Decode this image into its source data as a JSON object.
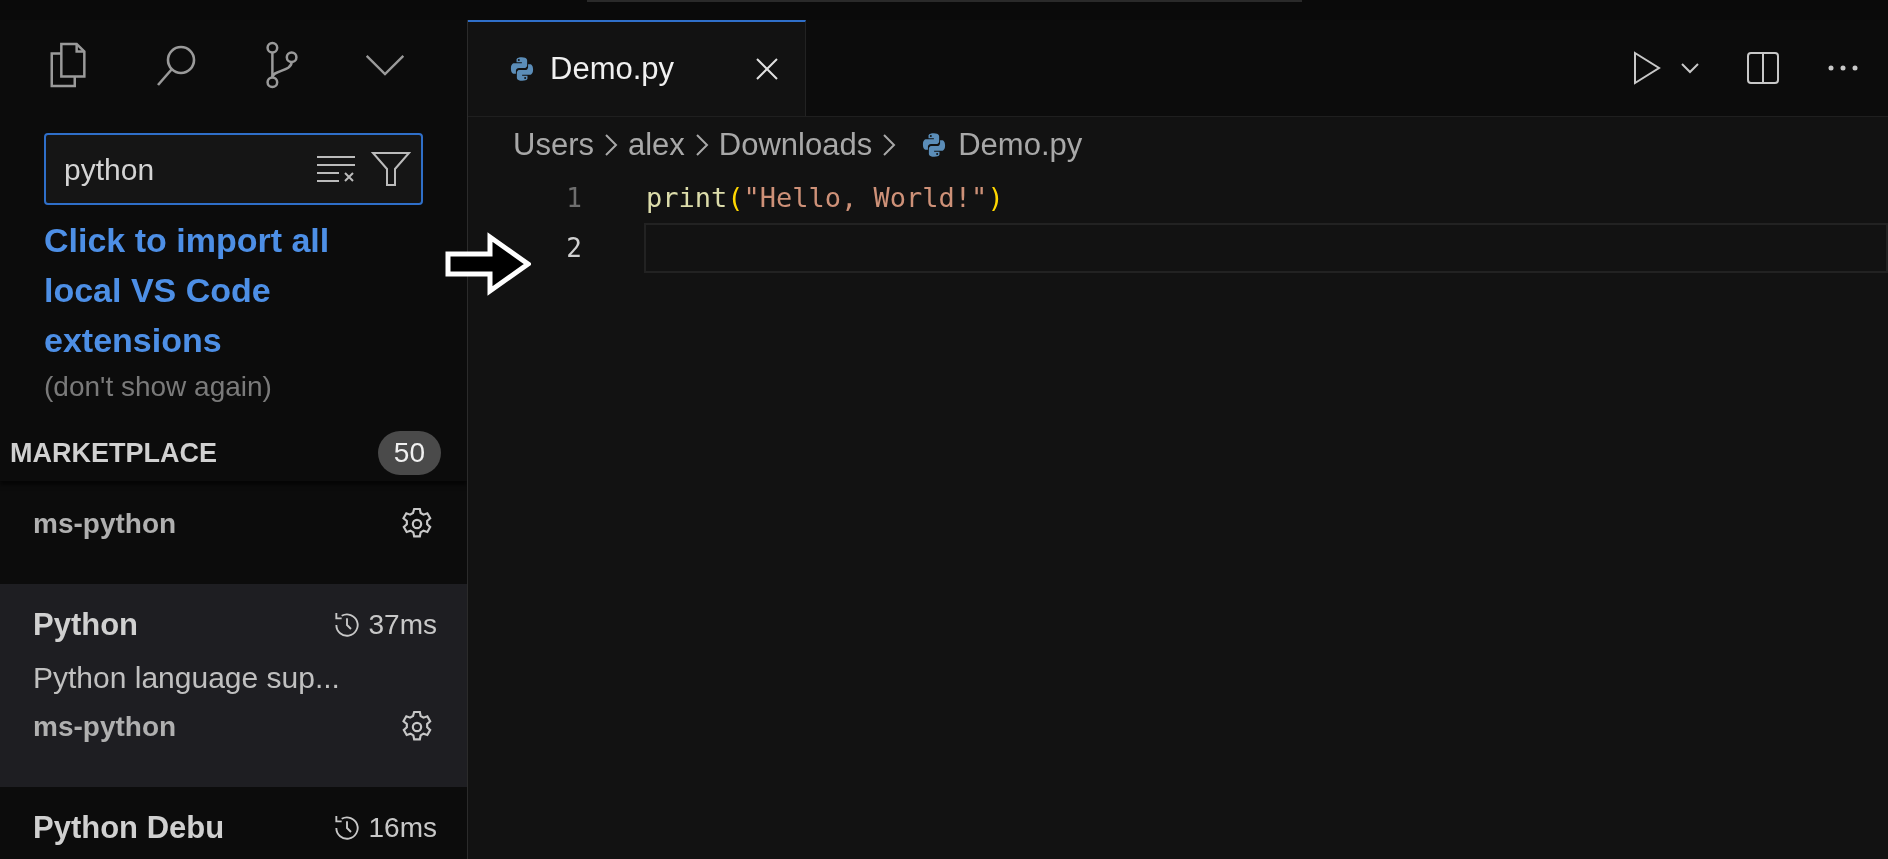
{
  "search": {
    "value": "python"
  },
  "import_notice": {
    "link": "Click to import all local VS Code extensions",
    "dismiss": "(don't show again)"
  },
  "marketplace": {
    "title": "MARKETPLACE",
    "count": "50",
    "items": [
      {
        "publisher": "ms-python",
        "selected": false
      },
      {
        "name": "Python",
        "time": "37ms",
        "description": "Python language sup...",
        "publisher": "ms-python",
        "selected": true
      },
      {
        "name": "Python Debu",
        "time": "16ms",
        "selected": false
      }
    ]
  },
  "editor": {
    "tabs": [
      {
        "label": "Demo.py",
        "selected": true
      }
    ],
    "breadcrumb": [
      "Users",
      "alex",
      "Downloads",
      "Demo.py"
    ],
    "lines": [
      {
        "number": "1",
        "current": false,
        "tokens": [
          {
            "kind": "function",
            "text": "print"
          },
          {
            "kind": "paren",
            "text": "("
          },
          {
            "kind": "string",
            "text": "\"Hello, World!\""
          },
          {
            "kind": "paren",
            "text": ")"
          }
        ]
      },
      {
        "number": "2",
        "current": true
      }
    ]
  }
}
